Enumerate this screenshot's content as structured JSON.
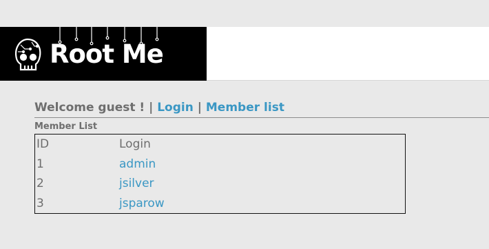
{
  "header": {
    "logo_text": "Root Me",
    "logo_icon": "skull-circuit-icon",
    "colors": {
      "logo_bg": "#000000",
      "band_bg": "#ffffff",
      "page_bg": "#e9e9e9"
    }
  },
  "nav": {
    "welcome": "Welcome guest !",
    "separator": "|",
    "login_label": "Login",
    "member_list_label": "Member list",
    "link_color": "#3a97c4"
  },
  "member_section": {
    "title": "Member List",
    "columns": [
      "ID",
      "Login"
    ],
    "rows": [
      {
        "id": "1",
        "login": "admin"
      },
      {
        "id": "2",
        "login": "jsilver"
      },
      {
        "id": "3",
        "login": "jsparow"
      }
    ]
  }
}
